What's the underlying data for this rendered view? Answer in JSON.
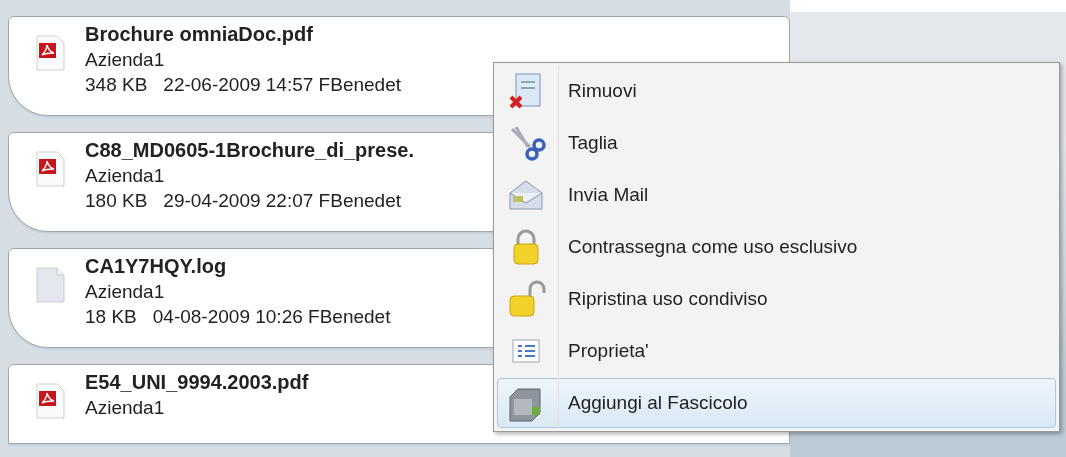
{
  "files": [
    {
      "kind": "pdf",
      "name": "Brochure omniaDoc.pdf",
      "owner": "Azienda1",
      "size": "348 KB",
      "info": "22-06-2009 14:57 FBenedet"
    },
    {
      "kind": "pdf",
      "name": "C88_MD0605-1Brochure_di_prese.",
      "owner": "Azienda1",
      "size": "180 KB",
      "info": "29-04-2009 22:07 FBenedet"
    },
    {
      "kind": "log",
      "name": "CA1Y7HQY.log",
      "owner": "Azienda1",
      "size": "18 KB",
      "info": "04-08-2009 10:26 FBenedet"
    },
    {
      "kind": "pdf",
      "name": "E54_UNI_9994.2003.pdf",
      "owner": "Azienda1"
    }
  ],
  "context_menu": [
    {
      "label": "Rimuovi",
      "selected": false
    },
    {
      "label": "Taglia",
      "selected": false
    },
    {
      "label": "Invia Mail",
      "selected": false
    },
    {
      "label": "Contrassegna come uso esclusivo",
      "selected": false
    },
    {
      "label": "Ripristina uso condiviso",
      "selected": false
    },
    {
      "label": "Proprieta'",
      "selected": false
    },
    {
      "label": "Aggiungi al Fascicolo",
      "selected": true
    }
  ]
}
